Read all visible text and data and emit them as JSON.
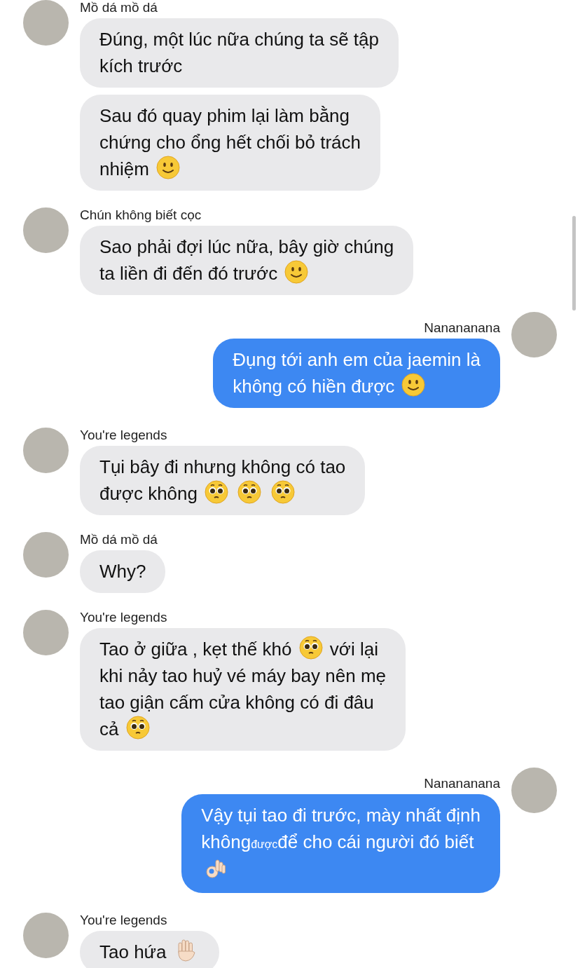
{
  "groups": [
    {
      "sender": "Mồ dá mồ dá",
      "kind": "incoming",
      "messages": [
        {
          "lines": [
            [
              {
                "kind": "text",
                "text": "Đúng, một lúc nữa chúng ta sẽ tập"
              }
            ],
            [
              {
                "kind": "text",
                "text": "kích trước"
              }
            ]
          ]
        },
        {
          "lines": [
            [
              {
                "kind": "text",
                "text": "Sau đó quay phim lại làm bằng"
              }
            ],
            [
              {
                "kind": "text",
                "text": "chứng cho ổng hết chối bỏ trách"
              }
            ],
            [
              {
                "kind": "text",
                "text": "nhiệm"
              },
              {
                "kind": "smile"
              }
            ]
          ]
        }
      ]
    },
    {
      "sender": "Chún không biết cọc",
      "kind": "incoming",
      "messages": [
        {
          "lines": [
            [
              {
                "kind": "text",
                "text": "Sao phải đợi lúc nữa, bây giờ chúng"
              }
            ],
            [
              {
                "kind": "text",
                "text": "ta liền đi đến đó trước"
              },
              {
                "kind": "smile"
              }
            ]
          ]
        }
      ]
    },
    {
      "sender": "Nanananana",
      "kind": "outgoing",
      "messages": [
        {
          "lines": [
            [
              {
                "kind": "text",
                "text": "Đụng tới anh em của jaemin là"
              }
            ],
            [
              {
                "kind": "text",
                "text": "không có hiền được"
              },
              {
                "kind": "smile"
              }
            ]
          ]
        }
      ]
    },
    {
      "sender": "You're legends",
      "kind": "incoming",
      "messages": [
        {
          "lines": [
            [
              {
                "kind": "text",
                "text": "Tụi bây đi nhưng không có tao"
              }
            ],
            [
              {
                "kind": "text",
                "text": "được không"
              },
              {
                "kind": "pleading"
              },
              {
                "kind": "pleading"
              },
              {
                "kind": "pleading"
              }
            ]
          ]
        }
      ]
    },
    {
      "sender": "Mồ dá mồ dá",
      "kind": "incoming",
      "messages": [
        {
          "lines": [
            [
              {
                "kind": "text",
                "text": "Why?"
              }
            ]
          ]
        }
      ]
    },
    {
      "sender": "You're legends",
      "kind": "incoming",
      "messages": [
        {
          "lines": [
            [
              {
                "kind": "text",
                "text": "Tao ở giữa , kẹt thế khó"
              },
              {
                "kind": "pleading"
              },
              {
                "kind": "text",
                "text": "với lại"
              }
            ],
            [
              {
                "kind": "text",
                "text": "khi nảy tao huỷ vé máy bay nên mẹ"
              }
            ],
            [
              {
                "kind": "text",
                "text": "tao giận cấm cửa không có đi đâu"
              }
            ],
            [
              {
                "kind": "text",
                "text": "cả"
              },
              {
                "kind": "pleading"
              }
            ]
          ]
        }
      ]
    },
    {
      "sender": "Nanananana",
      "kind": "outgoing",
      "messages": [
        {
          "lines": [
            [
              {
                "kind": "text",
                "text": "Vậy tụi tao đi trước, mày nhất định"
              }
            ],
            [
              {
                "kind": "text",
                "text": "không"
              },
              {
                "kind": "small",
                "text": "được"
              },
              {
                "kind": "text",
                "text": "để cho cái người đó biết"
              }
            ],
            [
              {
                "kind": "ok"
              }
            ]
          ]
        }
      ]
    },
    {
      "sender": "You're legends",
      "kind": "incoming",
      "messages": [
        {
          "lines": [
            [
              {
                "kind": "text",
                "text": "Tao hứa"
              },
              {
                "kind": "raised"
              }
            ]
          ]
        }
      ]
    }
  ]
}
